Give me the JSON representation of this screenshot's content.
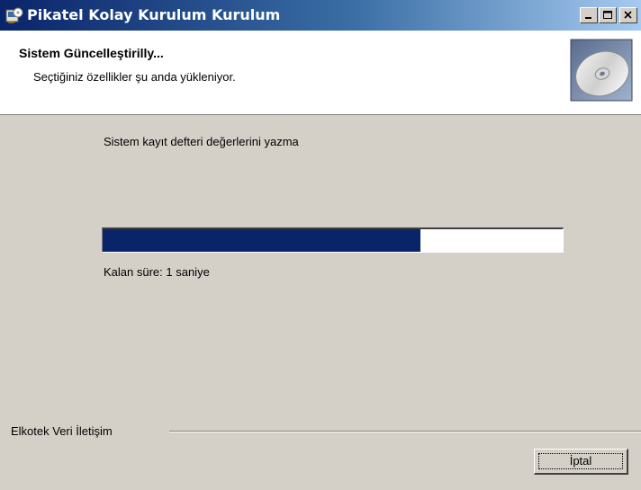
{
  "window": {
    "title": "Pikatel Kolay Kurulum Kurulum",
    "icon": "installer-app-icon"
  },
  "header": {
    "title": "Sistem Güncelleştirilly...",
    "subtitle": "Seçtiğiniz özellikler şu anda yükleniyor.",
    "image": "cd-disc-icon"
  },
  "main": {
    "status_text": "Sistem kayıt defteri değerlerini yazma",
    "progress_percent": 69,
    "remaining_text": "Kalan süre: 1 saniye"
  },
  "footer": {
    "brand": "Elkotek Veri İletişim",
    "cancel_label": "İptal"
  },
  "colors": {
    "titlebar_start": "#0a246a",
    "titlebar_end": "#a6caf0",
    "progress_fill": "#0a246a",
    "window_bg": "#d4d0c8"
  }
}
